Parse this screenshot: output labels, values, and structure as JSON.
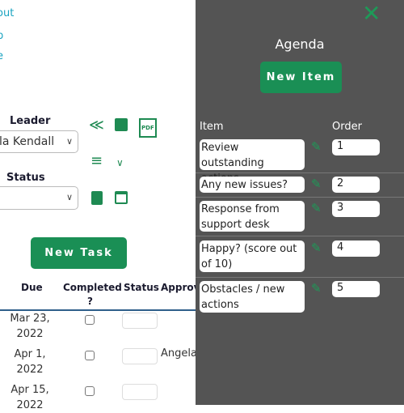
{
  "left": {
    "links": [
      "out",
      "p",
      "e"
    ],
    "leader_label": "Leader",
    "leader_value": "la Kendall",
    "status_label": "Status",
    "status_value": "",
    "icons": [
      "reply-all-icon",
      "save-icon",
      "pdf-icon",
      "list-icon",
      "chevron-down-icon",
      "clipboard-icon",
      "calendar-icon"
    ],
    "new_task": "New Task",
    "table": {
      "headers": [
        "Due",
        "Completed",
        "?",
        "Status",
        "Approv"
      ],
      "rows": [
        {
          "due1": "Mar 23,",
          "due2": "2022",
          "approver": ""
        },
        {
          "due1": "Apr 1,",
          "due2": "2022",
          "approver": "Angela"
        },
        {
          "due1": "Apr 15,",
          "due2": "2022",
          "approver": ""
        }
      ]
    }
  },
  "panel": {
    "title": "Agenda",
    "new_item": "New Item",
    "col_item": "Item",
    "col_order": "Order",
    "items": [
      {
        "text": "Review outstanding actions",
        "order": "1"
      },
      {
        "text": "Any new issues?",
        "order": "2"
      },
      {
        "text": "Response from support desk",
        "order": "3"
      },
      {
        "text": "Happy? (score out of 10)",
        "order": "4"
      },
      {
        "text": "Obstacles / new actions",
        "order": "5"
      }
    ]
  },
  "colors": {
    "accent": "#1a8f55",
    "link": "#1aa3c0",
    "panel": "#545454"
  }
}
